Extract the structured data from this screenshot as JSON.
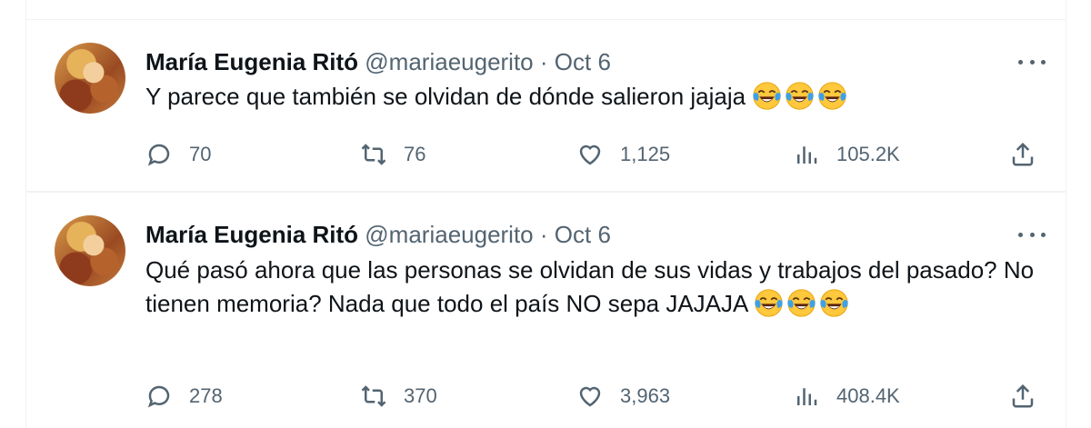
{
  "tweets": [
    {
      "author_name": "María Eugenia Ritó",
      "handle": "@mariaeugerito",
      "separator": "·",
      "date": "Oct 6",
      "text": "Y parece que también se olvidan de dónde salieron jajaja",
      "emoji_count": 3,
      "stats": {
        "replies": "70",
        "retweets": "76",
        "likes": "1,125",
        "views": "105.2K"
      }
    },
    {
      "author_name": "María Eugenia Ritó",
      "handle": "@mariaeugerito",
      "separator": "·",
      "date": "Oct 6",
      "text": "Qué pasó ahora que las personas se olvidan de sus vidas y trabajos del pasado? No tienen memoria? Nada que todo el país NO sepa JAJAJA",
      "emoji_count": 3,
      "stats": {
        "replies": "278",
        "retweets": "370",
        "likes": "3,963",
        "views": "408.4K"
      }
    }
  ],
  "icons": {
    "emoji": "face-with-tears-of-joy",
    "reply": "reply-icon",
    "retweet": "retweet-icon",
    "like": "heart-icon",
    "views": "views-icon",
    "share": "share-icon",
    "more": "more-icon"
  },
  "colors": {
    "text": "#0f1419",
    "secondary": "#536471",
    "border": "#eff3f4",
    "emoji_face": "#ffc83d",
    "emoji_tears": "#3fa0e6"
  }
}
